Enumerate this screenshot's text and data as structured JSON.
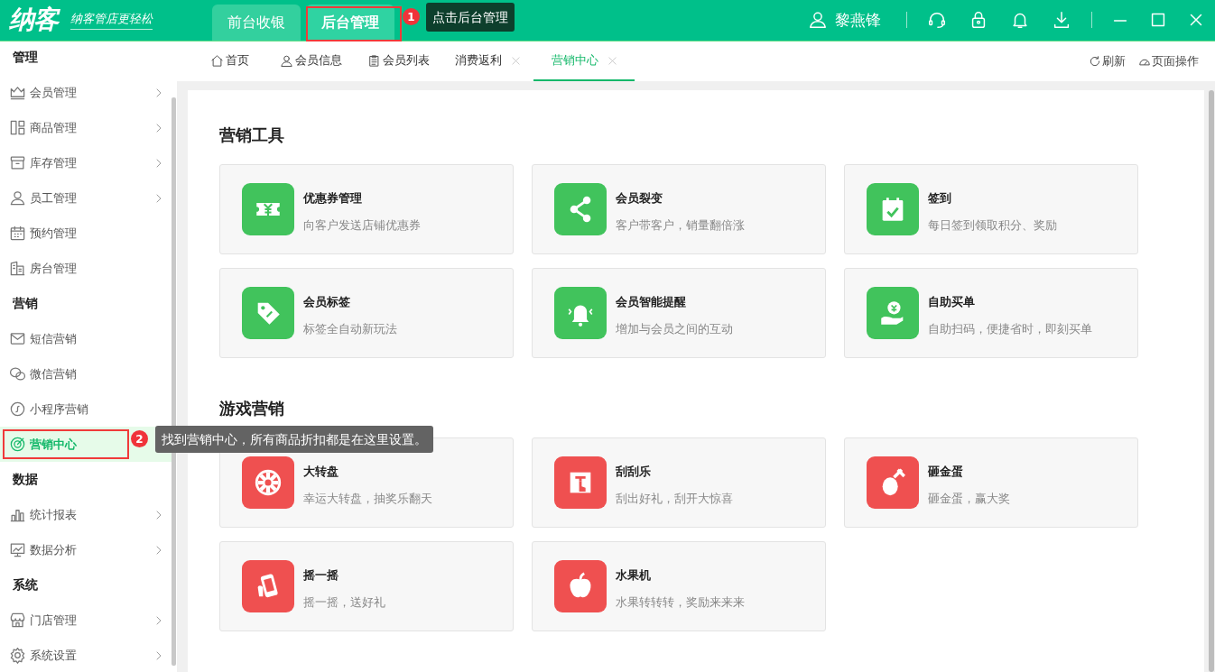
{
  "header": {
    "logo": "纳客",
    "slogan": "纳客管店更轻松",
    "top_tabs": [
      {
        "label": "前台收银",
        "selected": false
      },
      {
        "label": "后台管理",
        "selected": true
      }
    ],
    "user_name": "黎燕锋"
  },
  "sidebar": {
    "sections": [
      {
        "title": "管理",
        "items": [
          {
            "label": "会员管理",
            "expandable": true,
            "selected": false
          },
          {
            "label": "商品管理",
            "expandable": true,
            "selected": false
          },
          {
            "label": "库存管理",
            "expandable": true,
            "selected": false
          },
          {
            "label": "员工管理",
            "expandable": true,
            "selected": false
          },
          {
            "label": "预约管理",
            "expandable": false,
            "selected": false
          },
          {
            "label": "房台管理",
            "expandable": false,
            "selected": false
          }
        ]
      },
      {
        "title": "营销",
        "items": [
          {
            "label": "短信营销",
            "expandable": false,
            "selected": false
          },
          {
            "label": "微信营销",
            "expandable": false,
            "selected": false
          },
          {
            "label": "小程序营销",
            "expandable": false,
            "selected": false
          },
          {
            "label": "营销中心",
            "expandable": false,
            "selected": true
          }
        ]
      },
      {
        "title": "数据",
        "items": [
          {
            "label": "统计报表",
            "expandable": true,
            "selected": false
          },
          {
            "label": "数据分析",
            "expandable": true,
            "selected": false
          }
        ]
      },
      {
        "title": "系统",
        "items": [
          {
            "label": "门店管理",
            "expandable": true,
            "selected": false
          },
          {
            "label": "系统设置",
            "expandable": true,
            "selected": false
          }
        ]
      }
    ]
  },
  "page_tabs": {
    "tabs": [
      {
        "label": "首页",
        "closable": false,
        "selected": false
      },
      {
        "label": "会员信息",
        "closable": false,
        "selected": false
      },
      {
        "label": "会员列表",
        "closable": false,
        "selected": false
      },
      {
        "label": "消费返利",
        "closable": true,
        "selected": false
      },
      {
        "label": "营销中心",
        "closable": true,
        "selected": true
      }
    ],
    "actions": [
      "刷新",
      "页面操作"
    ]
  },
  "sections": [
    {
      "title": "营销工具",
      "color": "#41c35c",
      "tools": [
        {
          "title": "优惠券管理",
          "description": "向客户发送店铺优惠券"
        },
        {
          "title": "会员裂变",
          "description": "客户带客户，销量翻倍涨"
        },
        {
          "title": "签到",
          "description": "每日签到领取积分、奖励"
        },
        {
          "title": "会员标签",
          "description": "标签全自动新玩法"
        },
        {
          "title": "会员智能提醒",
          "description": "增加与会员之间的互动"
        },
        {
          "title": "自助买单",
          "description": "自助扫码，便捷省时，即刻买单"
        }
      ]
    },
    {
      "title": "游戏营销",
      "color": "#ef5050",
      "tools": [
        {
          "title": "大转盘",
          "description": "幸运大转盘，抽奖乐翻天"
        },
        {
          "title": "刮刮乐",
          "description": "刮出好礼，刮开大惊喜"
        },
        {
          "title": "砸金蛋",
          "description": "砸金蛋，赢大奖"
        },
        {
          "title": "摇一摇",
          "description": "摇一摇，送好礼"
        },
        {
          "title": "水果机",
          "description": "水果转转转，奖励来来来"
        }
      ]
    }
  ],
  "annotations": [
    {
      "kind": "top-tab",
      "number": "1",
      "text": "点击后台管理"
    },
    {
      "kind": "sidebar-item",
      "number": "2",
      "text": "找到营销中心，所有商品折扣都是在这里设置。"
    }
  ]
}
